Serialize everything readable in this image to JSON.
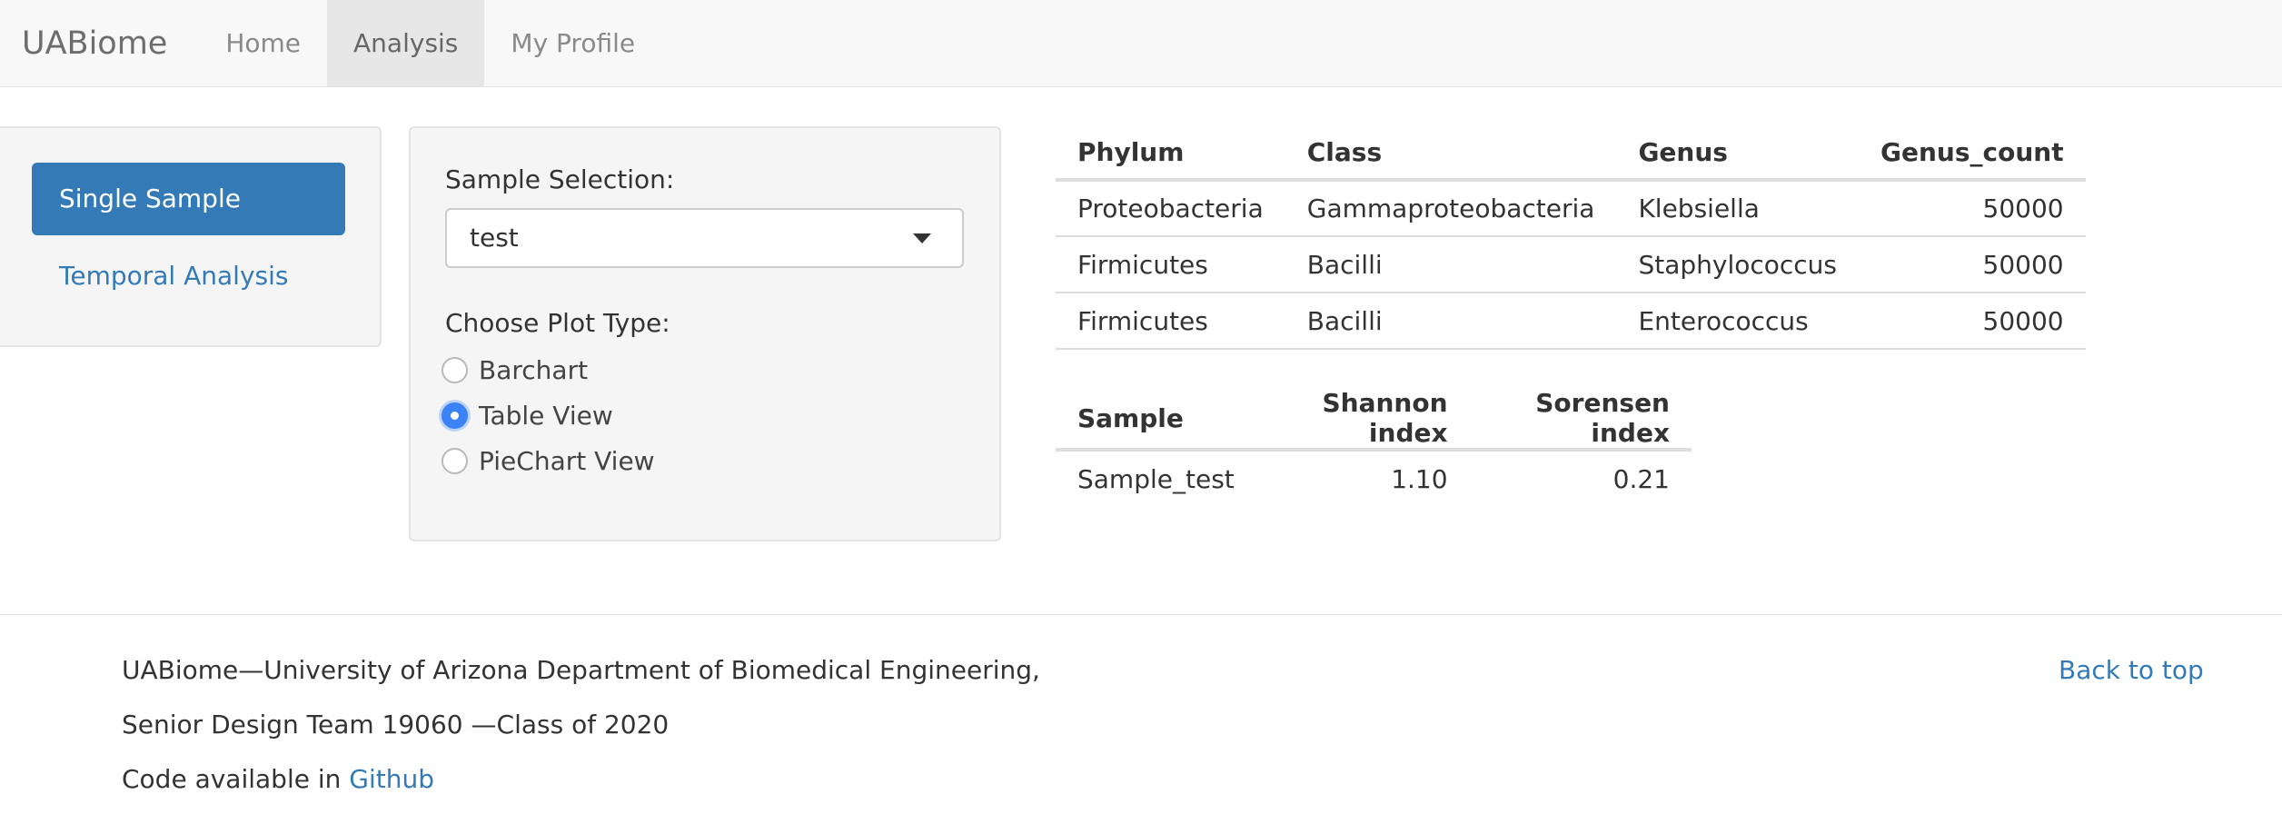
{
  "navbar": {
    "brand": "UABiome",
    "items": [
      {
        "label": "Home",
        "active": false
      },
      {
        "label": "Analysis",
        "active": true
      },
      {
        "label": "My Profile",
        "active": false
      }
    ]
  },
  "sidebar": {
    "pills": [
      {
        "label": "Single Sample",
        "active": true
      },
      {
        "label": "Temporal Analysis",
        "active": false
      }
    ]
  },
  "controls": {
    "sample_label": "Sample Selection:",
    "sample_value": "test",
    "plot_type_label": "Choose Plot Type:",
    "plot_options": [
      {
        "label": "Barchart",
        "checked": false
      },
      {
        "label": "Table View",
        "checked": true
      },
      {
        "label": "PieChart View",
        "checked": false
      }
    ]
  },
  "taxa_table": {
    "headers": [
      "Phylum",
      "Class",
      "Genus",
      "Genus_count"
    ],
    "rows": [
      [
        "Proteobacteria",
        "Gammaproteobacteria",
        "Klebsiella",
        "50000"
      ],
      [
        "Firmicutes",
        "Bacilli",
        "Staphylococcus",
        "50000"
      ],
      [
        "Firmicutes",
        "Bacilli",
        "Enterococcus",
        "50000"
      ]
    ]
  },
  "diversity_table": {
    "headers": [
      "Sample",
      "Shannon index",
      "Sorensen index"
    ],
    "rows": [
      [
        "Sample_test",
        "1.10",
        "0.21"
      ]
    ]
  },
  "footer": {
    "line1": "UABiome—University of Arizona Department of Biomedical Engineering,",
    "line2": "Senior Design Team 19060 —Class of 2020",
    "line3_prefix": "Code available in ",
    "line3_link": "Github",
    "back_to_top": "Back to top"
  },
  "colors": {
    "primary": "#337ab7",
    "radio_checked": "#3b82f6",
    "navbar_bg": "#f8f8f8"
  }
}
